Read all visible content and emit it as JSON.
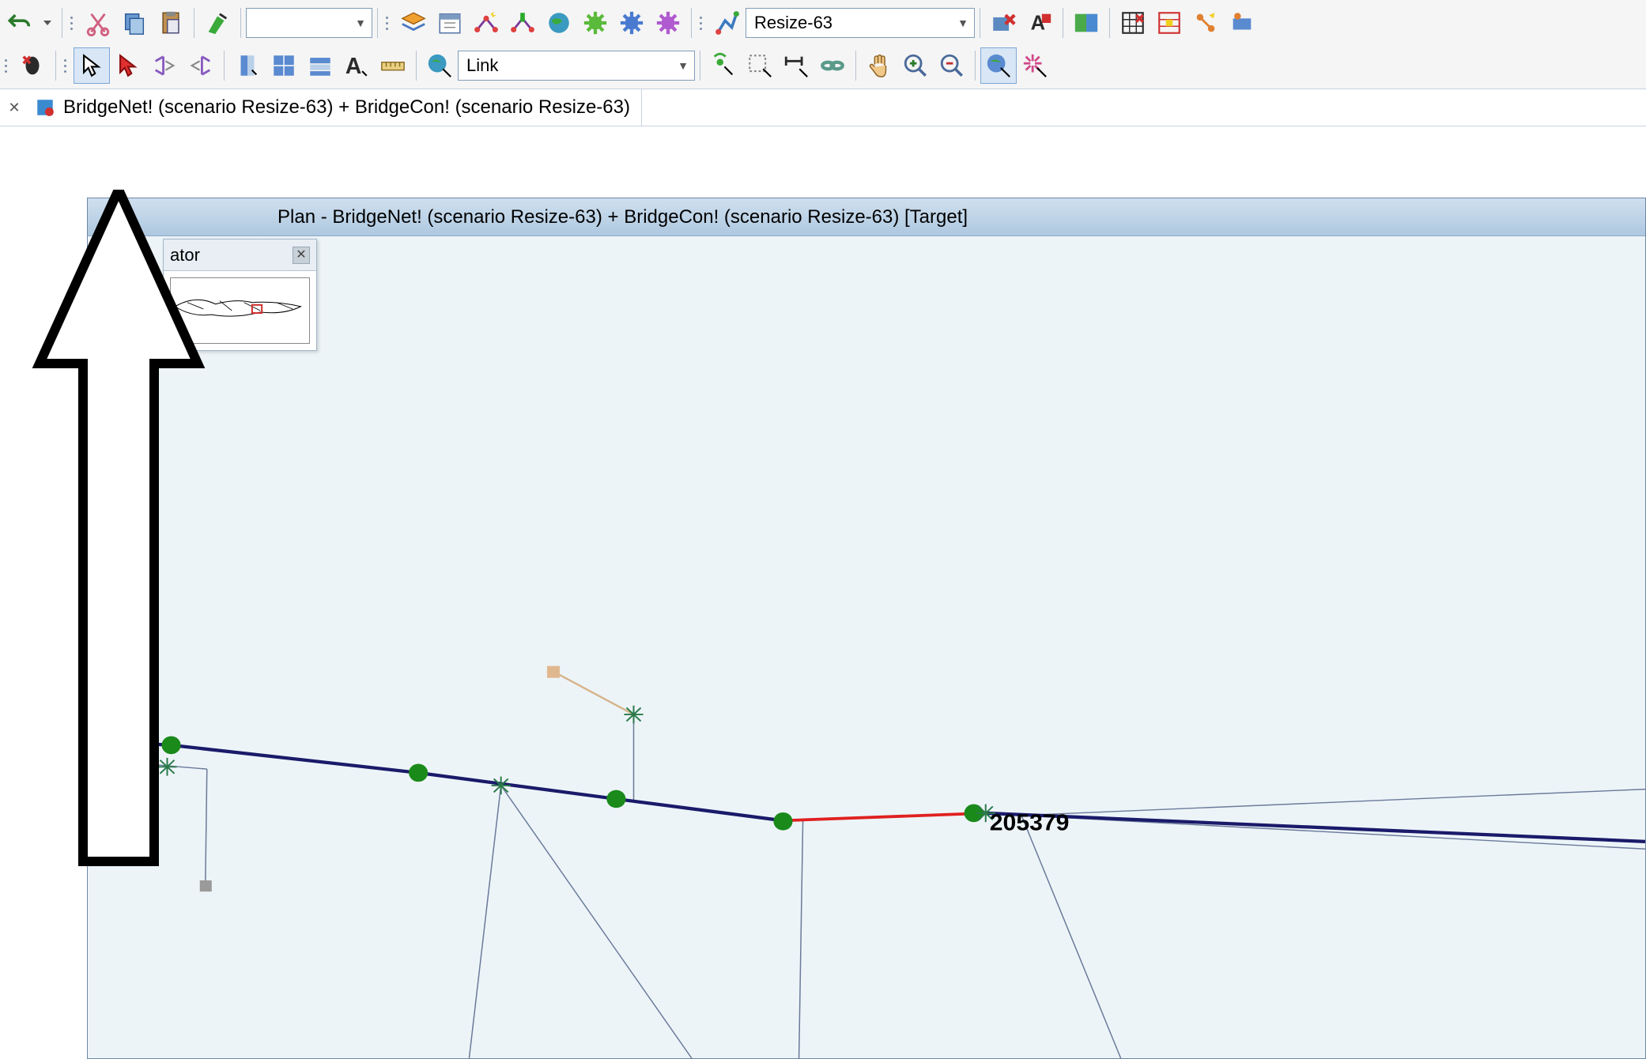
{
  "toolbar1": {
    "combo_empty": "",
    "combo_scenario": "Resize-63"
  },
  "toolbar2": {
    "combo_link": "Link"
  },
  "tabstrip": {
    "tab_label": "BridgeNet! (scenario Resize-63)  + BridgeCon! (scenario Resize-63)"
  },
  "inner_window": {
    "title": "Plan - BridgeNet! (scenario Resize-63)  + BridgeCon! (scenario Resize-63)  [Target]"
  },
  "navigator": {
    "title_suffix": "ator"
  },
  "network": {
    "node_label": "205379"
  },
  "colors": {
    "node_green": "#1a8a1a",
    "link_blue": "#1a1a6a",
    "link_red": "#e02020",
    "selection_bg": "#d8e6f5"
  }
}
